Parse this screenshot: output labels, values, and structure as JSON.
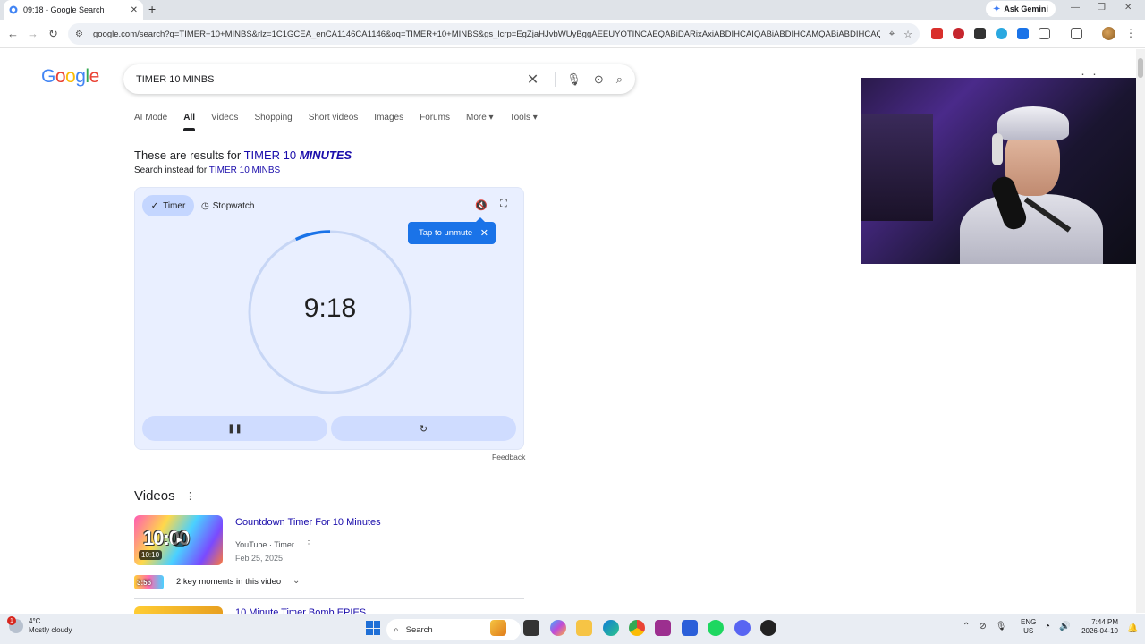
{
  "browser": {
    "tab_title": "09:18 - Google Search",
    "new_tab_glyph": "+",
    "tab_close_glyph": "✕",
    "ask_gemini": "Ask Gemini",
    "url": "google.com/search?q=TIMER+10+MINBS&rlz=1C1GCEA_enCA1146CA1146&oq=TIMER+10+MINBS&gs_lcrp=EgZjaHJvbWUyBggAEEUYOTINCAEQABiDARixAxiABDIHCAIQABiABDIHCAMQABiABDIHCAQQABiAB...",
    "back_glyph": "←",
    "forward_glyph": "→",
    "reload_glyph": "↻"
  },
  "google": {
    "logo_letters": [
      {
        "ch": "G",
        "color": "#4285f4"
      },
      {
        "ch": "o",
        "color": "#ea4335"
      },
      {
        "ch": "o",
        "color": "#fbbc05"
      },
      {
        "ch": "g",
        "color": "#4285f4"
      },
      {
        "ch": "l",
        "color": "#34a853"
      },
      {
        "ch": "e",
        "color": "#ea4335"
      }
    ],
    "query": "TIMER 10 MINBS",
    "tabs": [
      {
        "label": "AI Mode",
        "active": false
      },
      {
        "label": "All",
        "active": true
      },
      {
        "label": "Videos",
        "active": false
      },
      {
        "label": "Shopping",
        "active": false
      },
      {
        "label": "Short videos",
        "active": false
      },
      {
        "label": "Images",
        "active": false
      },
      {
        "label": "Forums",
        "active": false
      },
      {
        "label": "More ▾",
        "active": false
      },
      {
        "label": "Tools ▾",
        "active": false
      }
    ]
  },
  "spelling": {
    "prefix": "These are results for ",
    "corrected_a": "TIMER 10 ",
    "corrected_b": "MINUTES",
    "instead_prefix": "Search instead for ",
    "original": "TIMER 10 MINBS"
  },
  "timer": {
    "timer_tab": "Timer",
    "stopwatch_tab": "Stopwatch",
    "tooltip": "Tap to unmute",
    "display": "9:18",
    "elapsed_fraction": 0.07,
    "feedback": "Feedback",
    "accent": "#1a73e8",
    "ring_color": "#c7d6f5"
  },
  "videos": {
    "heading": "Videos",
    "items": [
      {
        "title": "Countdown Timer For 10 Minutes",
        "source": "YouTube · Timer",
        "date": "Feb 25, 2025",
        "duration": "10:10",
        "thumb_text": "10:00"
      },
      {
        "title": "10 Minute Timer Bomb EPIES"
      }
    ],
    "key_moments_time": "3:56",
    "key_moments_label": "2 key moments in this video"
  },
  "taskbar": {
    "weather_temp": "4°C",
    "weather_desc": "Mostly cloudy",
    "weather_badge": "1",
    "search_placeholder": "Search",
    "lang_1": "ENG",
    "lang_2": "US",
    "time": "7:44 PM",
    "date": "2026-04-10"
  }
}
